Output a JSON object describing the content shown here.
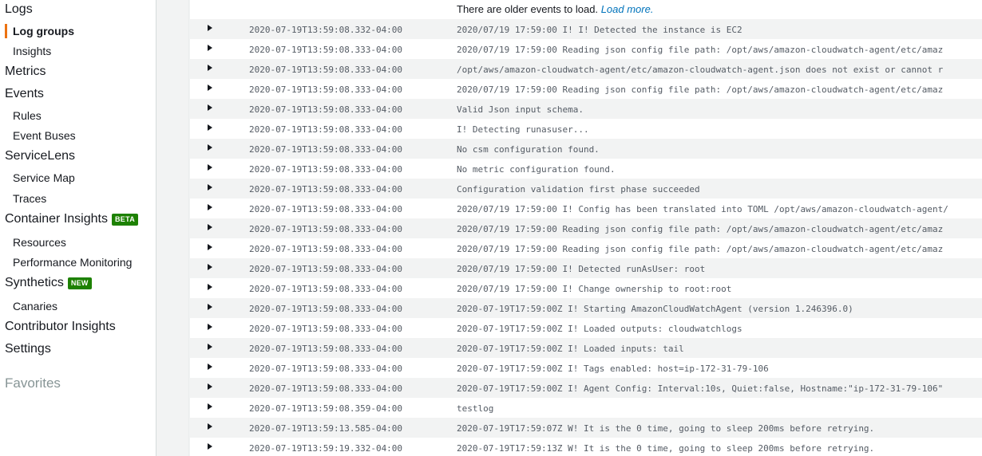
{
  "sidebar": {
    "logs": "Logs",
    "log_groups": "Log groups",
    "insights": "Insights",
    "metrics": "Metrics",
    "events": "Events",
    "rules": "Rules",
    "event_buses": "Event Buses",
    "servicelens": "ServiceLens",
    "service_map": "Service Map",
    "traces": "Traces",
    "container_insights": "Container Insights",
    "beta_badge": "BETA",
    "resources": "Resources",
    "performance_monitoring": "Performance Monitoring",
    "synthetics": "Synthetics",
    "new_badge": "NEW",
    "canaries": "Canaries",
    "contributor_insights": "Contributor Insights",
    "settings": "Settings",
    "favorites": "Favorites",
    "accent_color": "#ec7211"
  },
  "log": {
    "older_text": "There are older events to load.",
    "load_more": "Load more.",
    "rows": [
      {
        "ts": "2020-07-19T13:59:08.332-04:00",
        "msg": "2020/07/19 17:59:00 I! I! Detected the instance is EC2"
      },
      {
        "ts": "2020-07-19T13:59:08.333-04:00",
        "msg": "2020/07/19 17:59:00 Reading json config file path: /opt/aws/amazon-cloudwatch-agent/etc/amaz"
      },
      {
        "ts": "2020-07-19T13:59:08.333-04:00",
        "msg": "/opt/aws/amazon-cloudwatch-agent/etc/amazon-cloudwatch-agent.json does not exist or cannot r"
      },
      {
        "ts": "2020-07-19T13:59:08.333-04:00",
        "msg": "2020/07/19 17:59:00 Reading json config file path: /opt/aws/amazon-cloudwatch-agent/etc/amaz"
      },
      {
        "ts": "2020-07-19T13:59:08.333-04:00",
        "msg": "Valid Json input schema."
      },
      {
        "ts": "2020-07-19T13:59:08.333-04:00",
        "msg": "I! Detecting runasuser..."
      },
      {
        "ts": "2020-07-19T13:59:08.333-04:00",
        "msg": "No csm configuration found."
      },
      {
        "ts": "2020-07-19T13:59:08.333-04:00",
        "msg": "No metric configuration found."
      },
      {
        "ts": "2020-07-19T13:59:08.333-04:00",
        "msg": "Configuration validation first phase succeeded"
      },
      {
        "ts": "2020-07-19T13:59:08.333-04:00",
        "msg": "2020/07/19 17:59:00 I! Config has been translated into TOML /opt/aws/amazon-cloudwatch-agent/"
      },
      {
        "ts": "2020-07-19T13:59:08.333-04:00",
        "msg": "2020/07/19 17:59:00 Reading json config file path: /opt/aws/amazon-cloudwatch-agent/etc/amaz"
      },
      {
        "ts": "2020-07-19T13:59:08.333-04:00",
        "msg": "2020/07/19 17:59:00 Reading json config file path: /opt/aws/amazon-cloudwatch-agent/etc/amaz"
      },
      {
        "ts": "2020-07-19T13:59:08.333-04:00",
        "msg": "2020/07/19 17:59:00 I! Detected runAsUser: root"
      },
      {
        "ts": "2020-07-19T13:59:08.333-04:00",
        "msg": "2020/07/19 17:59:00 I! Change ownership to root:root"
      },
      {
        "ts": "2020-07-19T13:59:08.333-04:00",
        "msg": "2020-07-19T17:59:00Z I! Starting AmazonCloudWatchAgent (version 1.246396.0)"
      },
      {
        "ts": "2020-07-19T13:59:08.333-04:00",
        "msg": "2020-07-19T17:59:00Z I! Loaded outputs: cloudwatchlogs"
      },
      {
        "ts": "2020-07-19T13:59:08.333-04:00",
        "msg": "2020-07-19T17:59:00Z I! Loaded inputs: tail"
      },
      {
        "ts": "2020-07-19T13:59:08.333-04:00",
        "msg": "2020-07-19T17:59:00Z I! Tags enabled: host=ip-172-31-79-106"
      },
      {
        "ts": "2020-07-19T13:59:08.333-04:00",
        "msg": "2020-07-19T17:59:00Z I! Agent Config: Interval:10s, Quiet:false, Hostname:\"ip-172-31-79-106\""
      },
      {
        "ts": "2020-07-19T13:59:08.359-04:00",
        "msg": "testlog"
      },
      {
        "ts": "2020-07-19T13:59:13.585-04:00",
        "msg": "2020-07-19T17:59:07Z W! It is the 0 time, going to sleep 200ms before retrying."
      },
      {
        "ts": "2020-07-19T13:59:19.332-04:00",
        "msg": "2020-07-19T17:59:13Z W! It is the 0 time, going to sleep 200ms before retrying."
      }
    ]
  }
}
